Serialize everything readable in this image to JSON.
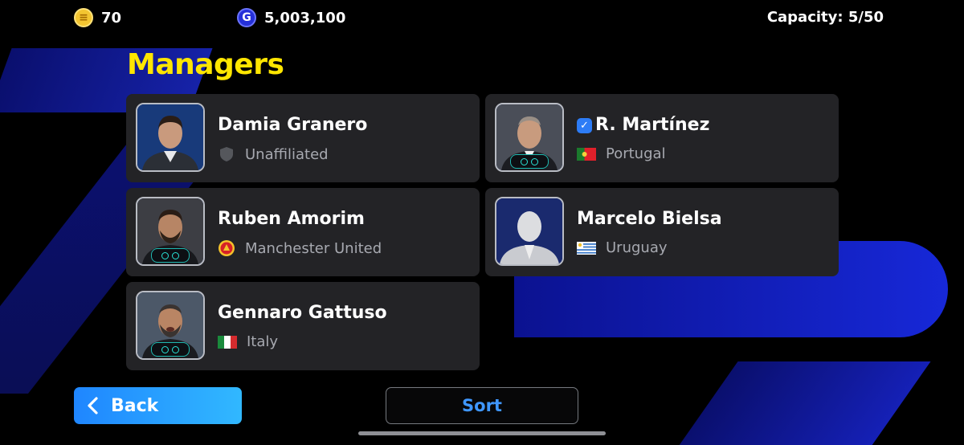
{
  "currencies": {
    "coins": {
      "icon": "efootball-coin-icon",
      "value": "70"
    },
    "gp": {
      "icon": "gp-coin-icon",
      "value": "5,003,100"
    }
  },
  "capacity": "Capacity: 5/50",
  "page_title": "Managers",
  "managers": [
    {
      "name": "Damia Granero",
      "team": "Unaffiliated",
      "team_icon": "shield-icon",
      "verified": false
    },
    {
      "name": "R. Martínez",
      "team": "Portugal",
      "team_icon": "portugal-flag-icon",
      "verified": true
    },
    {
      "name": "Ruben Amorim",
      "team": "Manchester United",
      "team_icon": "manchester-united-badge-icon",
      "verified": false
    },
    {
      "name": "Marcelo Bielsa",
      "team": "Uruguay",
      "team_icon": "uruguay-flag-icon",
      "verified": false
    },
    {
      "name": "Gennaro Gattuso",
      "team": "Italy",
      "team_icon": "italy-flag-icon",
      "verified": false
    }
  ],
  "buttons": {
    "back": "Back",
    "sort": "Sort"
  },
  "colors": {
    "title": "#ffe600",
    "back_button": "#1f86ff",
    "sort_text": "#3f97ff",
    "card": "#232326"
  }
}
